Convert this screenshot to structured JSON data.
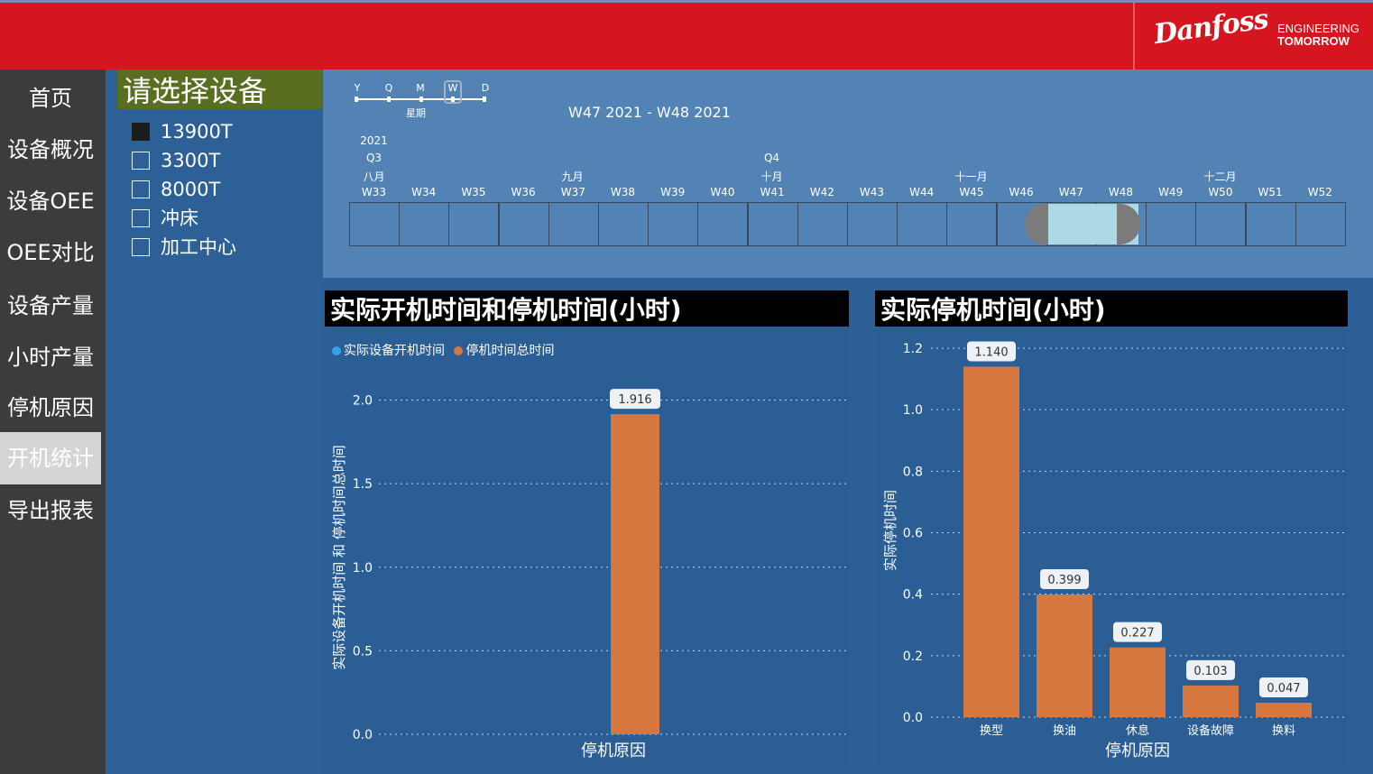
{
  "brand": {
    "logo_text": "Danfoss",
    "tagline_line1": "ENGINEERING",
    "tagline_line2": "TOMORROW",
    "red": "#d5151f"
  },
  "nav": {
    "items": [
      "首页",
      "设备概况",
      "设备OEE",
      "OEE对比",
      "设备产量",
      "小时产量",
      "停机原因",
      "开机统计",
      "导出报表"
    ],
    "active": "开机统计"
  },
  "device_panel": {
    "title": "请选择设备",
    "items": [
      {
        "label": "13900T",
        "checked": true
      },
      {
        "label": "3300T",
        "checked": false
      },
      {
        "label": "8000T",
        "checked": false
      },
      {
        "label": "冲床",
        "checked": false
      },
      {
        "label": "加工中心",
        "checked": false
      }
    ]
  },
  "timeline": {
    "scale": {
      "options": [
        "Y",
        "Q",
        "M",
        "W",
        "D"
      ],
      "selected": "W",
      "label": "星期"
    },
    "range_text": "W47 2021 - W48 2021",
    "year": "2021",
    "quarters": [
      "Q3",
      "Q4"
    ],
    "months": [
      "八月",
      "九月",
      "十月",
      "十一月",
      "十二月"
    ],
    "weeks": [
      "W33",
      "W34",
      "W35",
      "W36",
      "W37",
      "W38",
      "W39",
      "W40",
      "W41",
      "W42",
      "W43",
      "W44",
      "W45",
      "W46",
      "W47",
      "W48",
      "W49",
      "W50",
      "W51",
      "W52"
    ],
    "selected_weeks": [
      "W47",
      "W48"
    ]
  },
  "chart_data": [
    {
      "type": "bar",
      "title": "实际开机时间和停机时间(小时)",
      "legend": [
        "实际设备开机时间",
        "停机时间总时间"
      ],
      "legend_colors": [
        "#36a2eb",
        "#d5773f"
      ],
      "xlabel": "停机原因",
      "ylabel": "实际设备开机时间 和 停机时间总时间",
      "ylim": [
        0,
        2.1
      ],
      "yticks": [
        "0.0",
        "0.5",
        "1.0",
        "1.5",
        "2.0"
      ],
      "categories": [
        ""
      ],
      "series": [
        {
          "name": "实际设备开机时间",
          "values": [
            0
          ]
        },
        {
          "name": "停机时间总时间",
          "values": [
            1.916
          ]
        }
      ],
      "data_labels": [
        "1.916"
      ],
      "legend_position": "top-left",
      "grid": true
    },
    {
      "type": "bar",
      "title": "实际停机时间(小时)",
      "xlabel": "停机原因",
      "ylabel": "实际停机时间",
      "ylim": [
        0,
        1.2
      ],
      "yticks": [
        "0.0",
        "0.2",
        "0.4",
        "0.6",
        "0.8",
        "1.0",
        "1.2"
      ],
      "categories": [
        "换型",
        "换油",
        "休息",
        "设备故障",
        "换料"
      ],
      "values": [
        1.14,
        0.399,
        0.227,
        0.103,
        0.047
      ],
      "data_labels": [
        "1.140",
        "0.399",
        "0.227",
        "0.103",
        "0.047"
      ],
      "bar_color": "#d5773f",
      "grid": true
    }
  ]
}
